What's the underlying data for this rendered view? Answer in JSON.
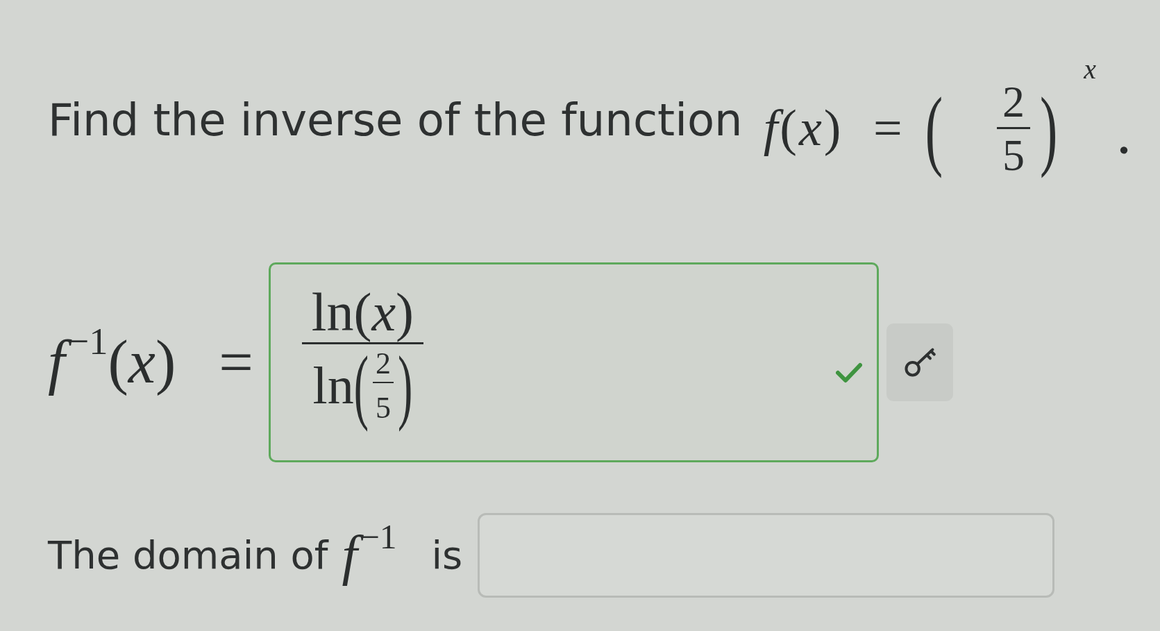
{
  "question": {
    "text": "Find the inverse of the function",
    "formula": {
      "lhs": "*f*(*x*) =",
      "open": "(",
      "numerator": "2",
      "denominator": "5",
      "close": ")",
      "exponent": "x",
      "period": "."
    }
  },
  "answer": {
    "label": "*f*$^{−1}$(*x*) =",
    "correct": true,
    "numerator": "ln(*x*)",
    "denominator": {
      "function": "ln",
      "open": "(",
      "numerator": "2",
      "denominator": "5",
      "close": ")"
    }
  },
  "domain": {
    "text_before": "The domain of",
    "symbol": "*f*$^{−1}$",
    "text_after": "is"
  }
}
